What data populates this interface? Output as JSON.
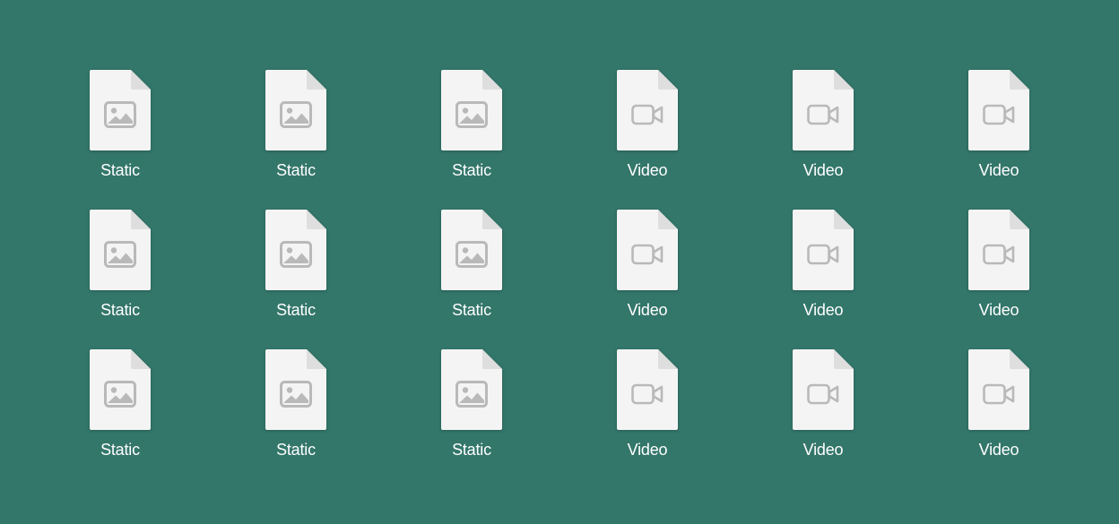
{
  "colors": {
    "desktop_background": "#33766a",
    "page_fill": "#f4f4f4",
    "page_fold": "#dedede",
    "glyph": "#b9b9b9",
    "label": "#ffffff"
  },
  "files": [
    {
      "label": "Static",
      "icon": "image-icon"
    },
    {
      "label": "Static",
      "icon": "image-icon"
    },
    {
      "label": "Static",
      "icon": "image-icon"
    },
    {
      "label": "Video",
      "icon": "video-camera-icon"
    },
    {
      "label": "Video",
      "icon": "video-camera-icon"
    },
    {
      "label": "Video",
      "icon": "video-camera-icon"
    },
    {
      "label": "Static",
      "icon": "image-icon"
    },
    {
      "label": "Static",
      "icon": "image-icon"
    },
    {
      "label": "Static",
      "icon": "image-icon"
    },
    {
      "label": "Video",
      "icon": "video-camera-icon"
    },
    {
      "label": "Video",
      "icon": "video-camera-icon"
    },
    {
      "label": "Video",
      "icon": "video-camera-icon"
    },
    {
      "label": "Static",
      "icon": "image-icon"
    },
    {
      "label": "Static",
      "icon": "image-icon"
    },
    {
      "label": "Static",
      "icon": "image-icon"
    },
    {
      "label": "Video",
      "icon": "video-camera-icon"
    },
    {
      "label": "Video",
      "icon": "video-camera-icon"
    },
    {
      "label": "Video",
      "icon": "video-camera-icon"
    }
  ]
}
